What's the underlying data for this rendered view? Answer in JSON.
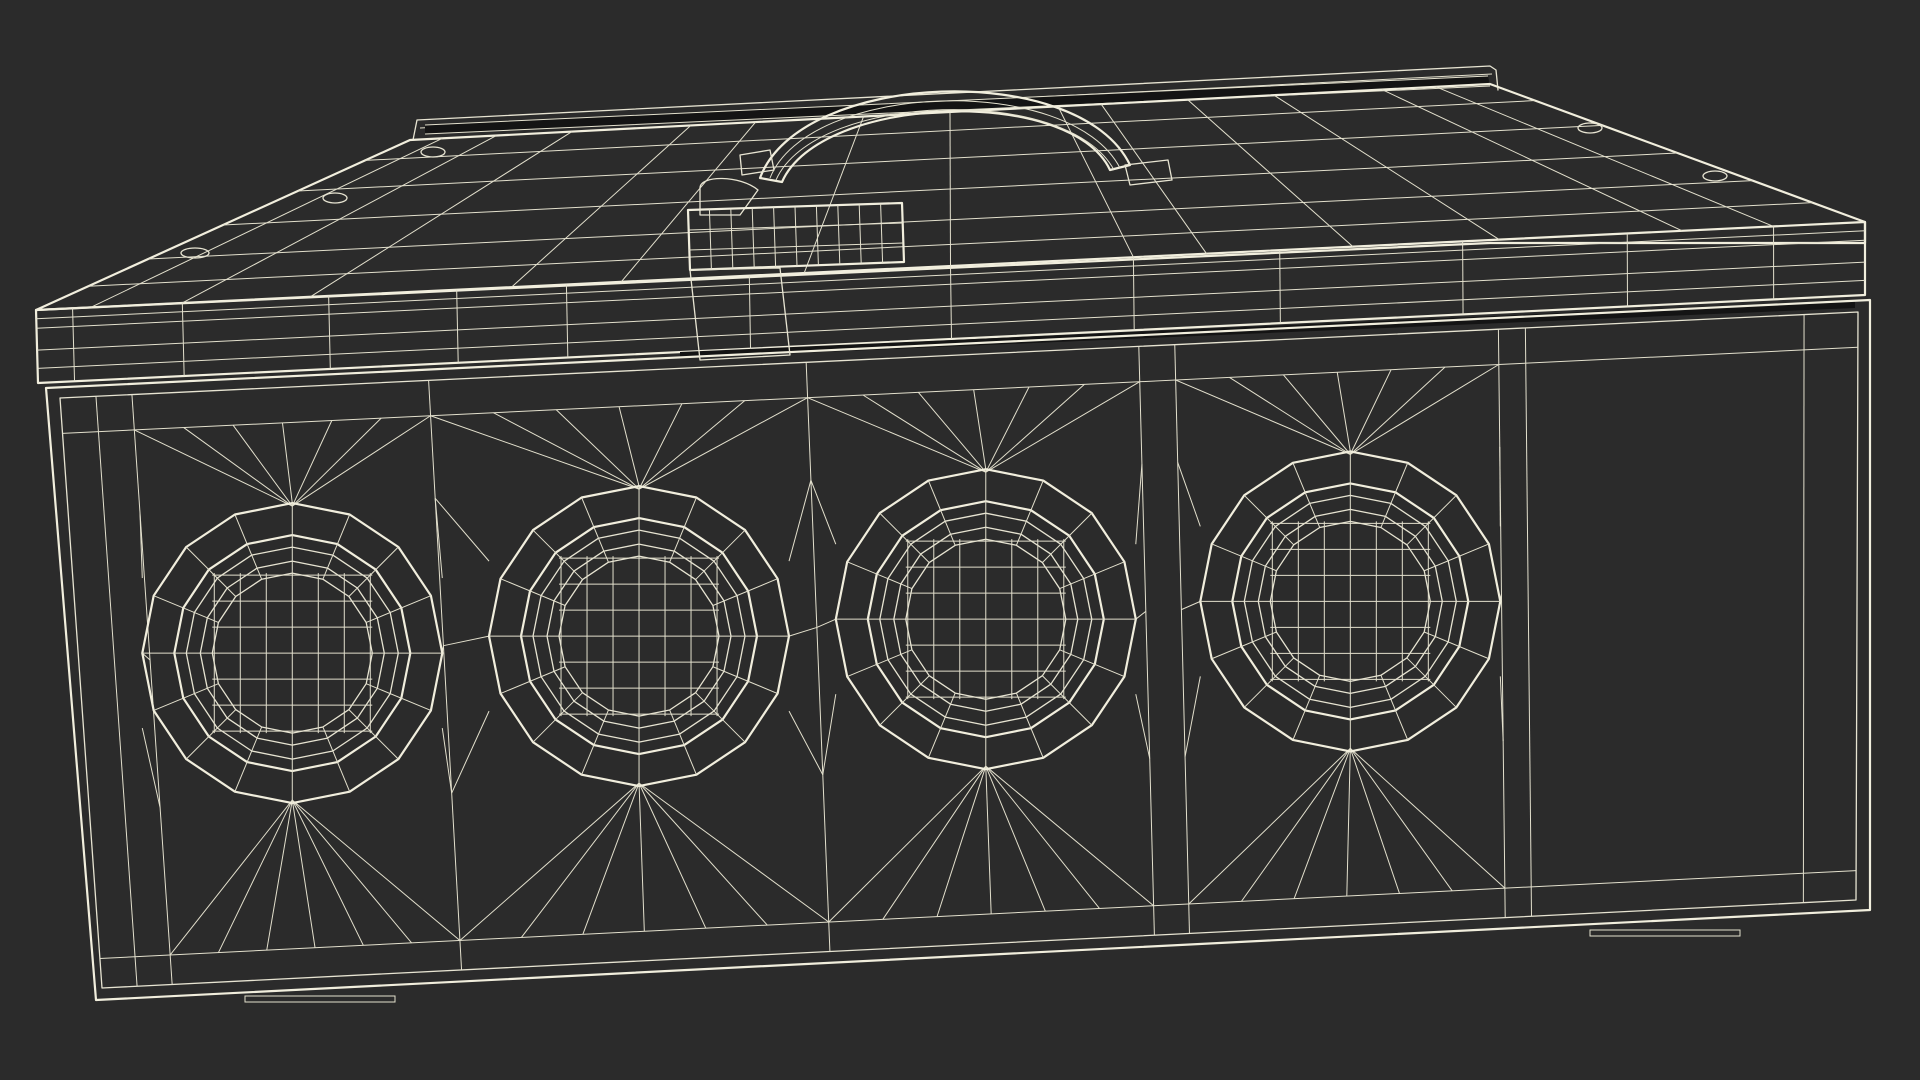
{
  "scene": {
    "background": "#2b2b2b",
    "object_fill": "#7b7c70",
    "lid_fill": "#7f8074",
    "wire_color": "#e7e4d2",
    "circle_count": 4
  }
}
